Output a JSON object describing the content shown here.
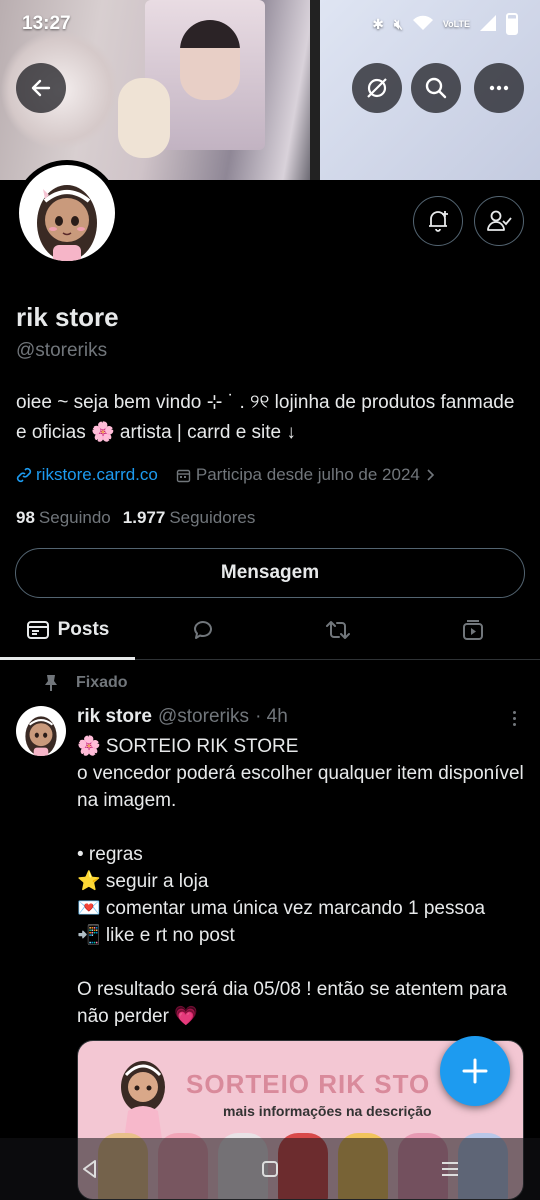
{
  "status_bar": {
    "time": "13:27",
    "indicators": "VoLTE"
  },
  "banner": {
    "back_icon": "arrow-left-icon",
    "icons": [
      "hide-icon",
      "search-icon",
      "more-icon"
    ]
  },
  "profile": {
    "name": "rik store",
    "handle": "@storeriks",
    "bio_line1": "oiee ~ seja bem vindo ⊹ ˙ . ୨୧ lojinha de produtos fanmade",
    "bio_line2": "e oficias 🌸 artista | carrd e site ↓",
    "link": "rikstore.carrd.co",
    "joined": "Participa desde julho de 2024",
    "following_count": "98",
    "following_label": "Seguindo",
    "followers_count": "1.977",
    "followers_label": "Seguidores",
    "message_button": "Mensagem"
  },
  "tabs": {
    "posts_label": "Posts"
  },
  "pinned_post": {
    "pinned_label": "Fixado",
    "author_name": "rik store",
    "author_handle": "@storeriks",
    "time": "· 4h",
    "text": "🌸 SORTEIO RIK STORE\no vencedor poderá escolher qualquer item disponível na imagem.\n\n• regras\n⭐ seguir a loja\n💌 comentar uma única vez marcando 1 pessoa\n📲 like e rt no post\n\nO resultado será dia 05/08 ! então se atentem para não perder 💗",
    "image_title": "SORTEIO RIK STO",
    "image_subtitle": "mais informações na descrição"
  },
  "colors": {
    "accent": "#1d9bf0",
    "background": "#000000",
    "muted": "#71767b",
    "text": "#e7e9ea",
    "border": "#536471"
  }
}
